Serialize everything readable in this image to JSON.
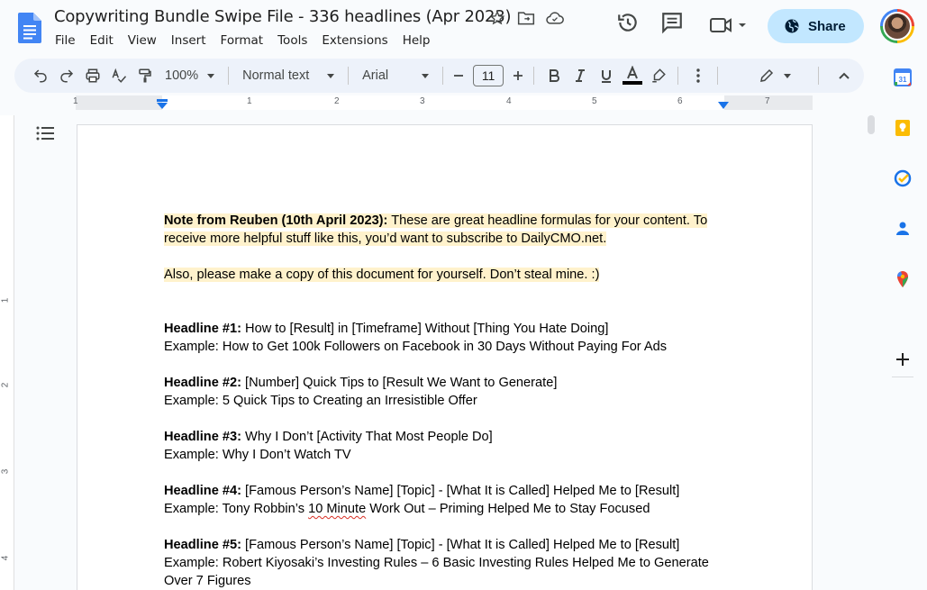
{
  "app": {
    "title": "Copywriting Bundle Swipe File - 336 headlines (Apr 2023)",
    "menu": [
      "File",
      "Edit",
      "View",
      "Insert",
      "Format",
      "Tools",
      "Extensions",
      "Help"
    ],
    "share_label": "Share",
    "accent_color": "#c2e7ff"
  },
  "toolbar": {
    "zoom": "100%",
    "style": "Normal text",
    "font": "Arial",
    "font_size": "11"
  },
  "ruler": {
    "numbers": [
      "1",
      "1",
      "2",
      "3",
      "4",
      "5",
      "6",
      "7"
    ],
    "vertical_numbers": [
      "1",
      "2",
      "3",
      "4"
    ]
  },
  "document": {
    "note": {
      "label": "Note from Reuben (10th April 2023):",
      "text": " These are great headline formulas for your content. To receive more helpful stuff like this, you’d want to subscribe to DailyCMO.net."
    },
    "note2": "Also, please make a copy of this document for yourself. Don’t steal mine. :)",
    "headlines": [
      {
        "label": "Headline #1:",
        "formula": " How to [Result] in [Timeframe] Without [Thing You Hate Doing]",
        "example": "Example: How to Get 100k Followers on Facebook in 30 Days Without Paying For Ads"
      },
      {
        "label": "Headline #2:",
        "formula": " [Number] Quick Tips to [Result We Want to Generate]",
        "example": "Example: 5 Quick Tips to Creating an Irresistible Offer"
      },
      {
        "label": "Headline #3:",
        "formula": " Why I Don’t [Activity That Most People Do]",
        "example": "Example: Why I Don’t Watch TV"
      },
      {
        "label": "Headline #4:",
        "formula": " [Famous Person’s Name] [Topic] - [What It is Called] Helped Me to [Result]",
        "example_pre": "Example: Tony Robbin’s ",
        "example_spell": "10 Minute",
        "example_post": " Work Out – Priming Helped Me to Stay Focused"
      },
      {
        "label": "Headline #5:",
        "formula": " [Famous Person’s Name] [Topic] - [What It is Called] Helped Me to [Result]",
        "example": "Example: Robert Kiyosaki’s Investing Rules – 6 Basic Investing Rules Helped Me to Generate Over 7 Figures"
      }
    ]
  },
  "side_panel": [
    "calendar-icon",
    "keep-icon",
    "tasks-icon",
    "contacts-icon",
    "maps-icon",
    "add-icon"
  ]
}
